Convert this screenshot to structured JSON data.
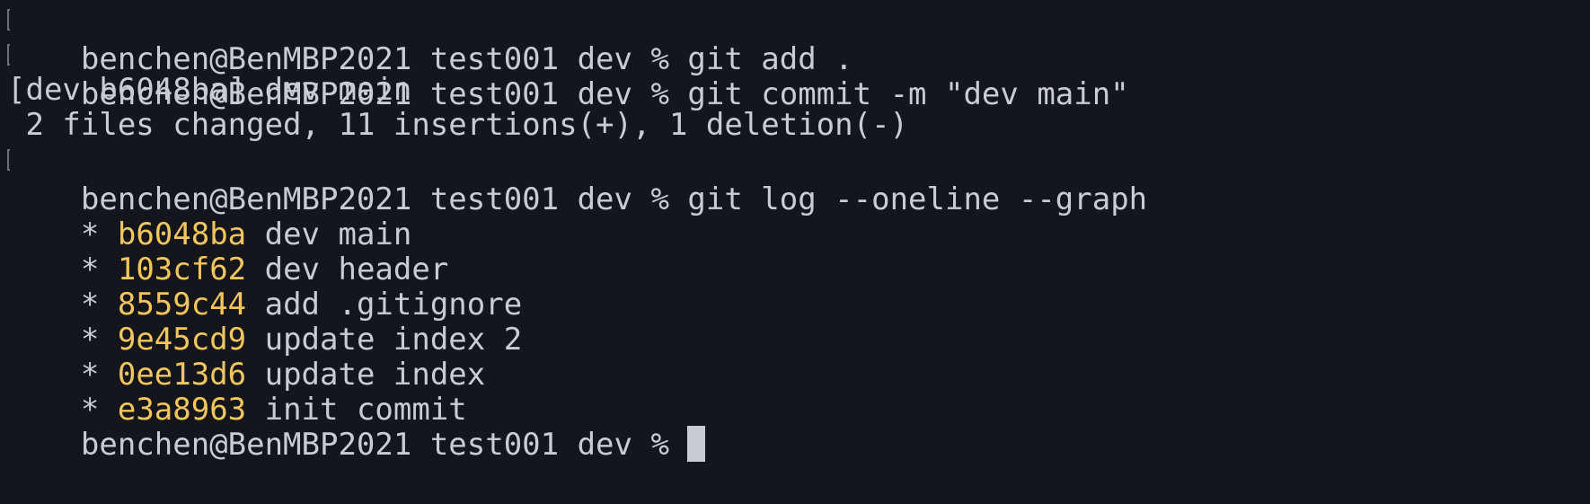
{
  "terminal": {
    "prompt": "benchen@BenMBP2021 test001 dev % ",
    "lines": [
      {
        "command": "git add ."
      },
      {
        "command": "git commit -m \"dev main\""
      },
      {
        "text": "[dev b6048ba] dev main"
      },
      {
        "text": " 2 files changed, 11 insertions(+), 1 deletion(-)"
      },
      {
        "command": "git log --oneline --graph"
      }
    ],
    "log": [
      {
        "graph": "* ",
        "hash": "b6048ba",
        "message": " dev main"
      },
      {
        "graph": "* ",
        "hash": "103cf62",
        "message": " dev header"
      },
      {
        "graph": "* ",
        "hash": "8559c44",
        "message": " add .gitignore"
      },
      {
        "graph": "* ",
        "hash": "9e45cd9",
        "message": " update index 2"
      },
      {
        "graph": "* ",
        "hash": "0ee13d6",
        "message": " update index"
      },
      {
        "graph": "* ",
        "hash": "e3a8963",
        "message": " init commit"
      }
    ],
    "colors": {
      "background": "#14161b",
      "text": "#c9cdd3",
      "hash": "#f2c65f"
    }
  }
}
